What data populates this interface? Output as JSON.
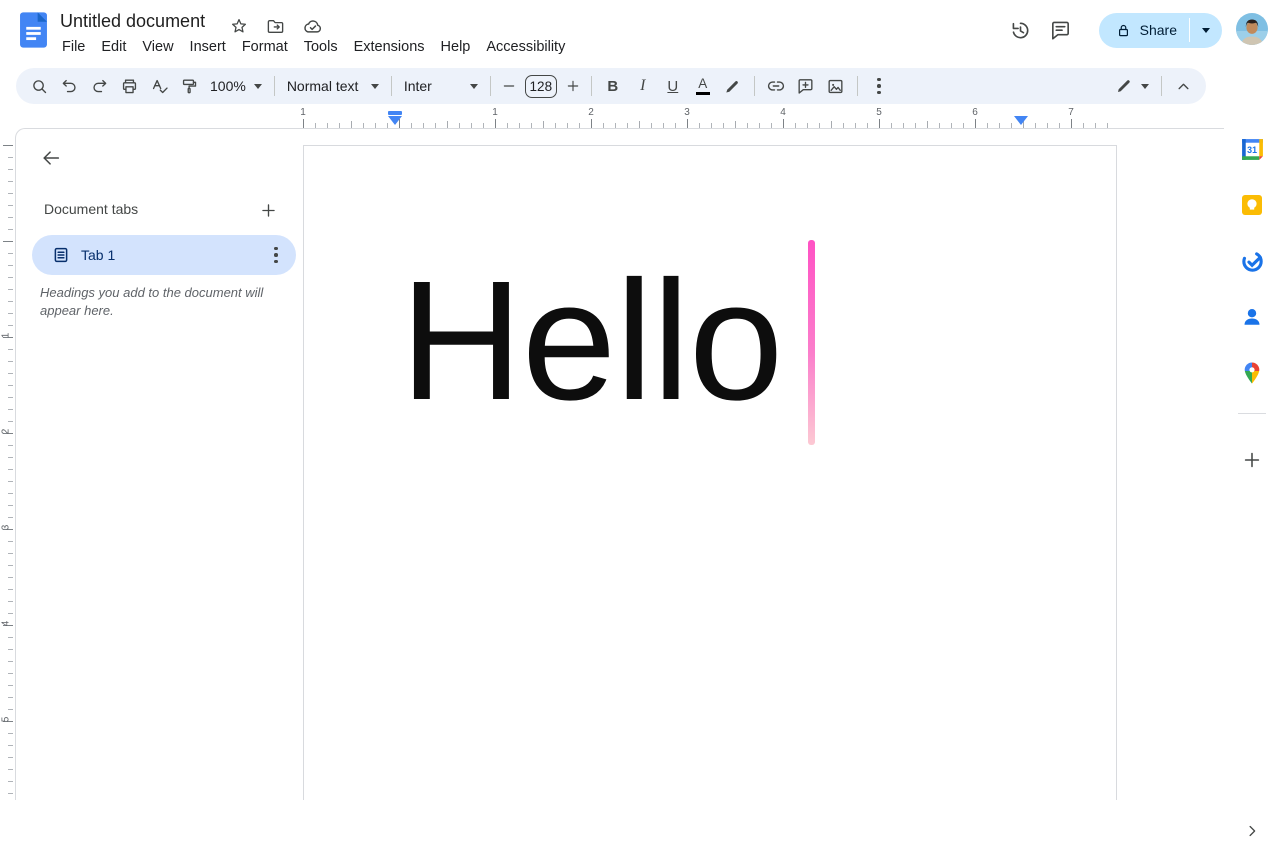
{
  "header": {
    "title": "Untitled document",
    "menu_items": [
      "File",
      "Edit",
      "View",
      "Insert",
      "Format",
      "Tools",
      "Extensions",
      "Help",
      "Accessibility"
    ],
    "share_label": "Share"
  },
  "toolbar": {
    "zoom_value": "100%",
    "style_value": "Normal text",
    "font_value": "Inter",
    "font_size_value": "128",
    "bold_label": "B",
    "italic_label": "I",
    "underline_label": "U",
    "text_color_label": "A"
  },
  "ruler": {
    "horizontal_numbers": [
      "1",
      "1",
      "2",
      "3",
      "4",
      "5",
      "6",
      "7"
    ],
    "vertical_numbers": [
      "1",
      "2",
      "3",
      "4",
      "5"
    ]
  },
  "tabs_panel": {
    "title": "Document tabs",
    "tab_label": "Tab 1",
    "outline_hint": "Headings you add to the document will appear here."
  },
  "document": {
    "text": "Hello"
  },
  "side_panel": {
    "calendar_day": "31",
    "icons": [
      "google-calendar-icon",
      "google-keep-icon",
      "google-tasks-icon",
      "google-contacts-icon",
      "google-maps-icon"
    ]
  },
  "colors": {
    "accent_blue": "#1a73e8",
    "toolbar_bg": "#edf2fa",
    "share_bg": "#c2e7ff",
    "active_tab_bg": "#d3e3fd",
    "active_tab_text": "#072f6c",
    "cursor_gradient_top": "#ff52c4",
    "cursor_gradient_bottom": "#fcc9d3"
  }
}
